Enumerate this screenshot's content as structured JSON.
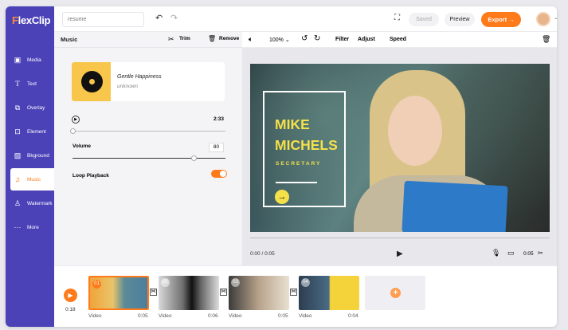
{
  "brand": {
    "name_prefix": "F",
    "name_rest": "lexClip"
  },
  "sidebar": {
    "items": [
      {
        "label": "Media",
        "icon": "media-icon"
      },
      {
        "label": "Text",
        "icon": "text-icon"
      },
      {
        "label": "Overlay",
        "icon": "overlay-icon"
      },
      {
        "label": "Element",
        "icon": "element-icon"
      },
      {
        "label": "Bkground",
        "icon": "background-icon"
      },
      {
        "label": "Music",
        "icon": "music-icon"
      },
      {
        "label": "Watermark",
        "icon": "watermark-icon"
      },
      {
        "label": "More",
        "icon": "more-icon"
      }
    ]
  },
  "topbar": {
    "project_name": "resume",
    "saved": "Saved",
    "preview": "Preview",
    "export": "Export"
  },
  "music_panel": {
    "title": "Music",
    "trim": "Trim",
    "remove": "Remove",
    "song_title": "Gentle Happiness",
    "artist": "unknown",
    "duration": "2:33",
    "volume_label": "Volume",
    "volume_value": "80",
    "loop_label": "Loop Playback",
    "loop_on": true
  },
  "stage_toolbar": {
    "zoom": "100%",
    "filter": "Filter",
    "adjust": "Adjust",
    "speed": "Speed"
  },
  "video_overlay": {
    "line1": "MIKE",
    "line2": "MICHELS",
    "line3": "SECRETARY"
  },
  "player": {
    "time": "0:00 / 0:05",
    "duration": "0:05"
  },
  "timeline": {
    "total": "0:18",
    "clips": [
      {
        "num": "01",
        "label": "Video",
        "duration": "0:05"
      },
      {
        "num": "02",
        "label": "Video",
        "duration": "0:06"
      },
      {
        "num": "03",
        "label": "Video",
        "duration": "0:05"
      },
      {
        "num": "04",
        "label": "Video",
        "duration": "0:04"
      }
    ],
    "add_symbol": "+"
  }
}
